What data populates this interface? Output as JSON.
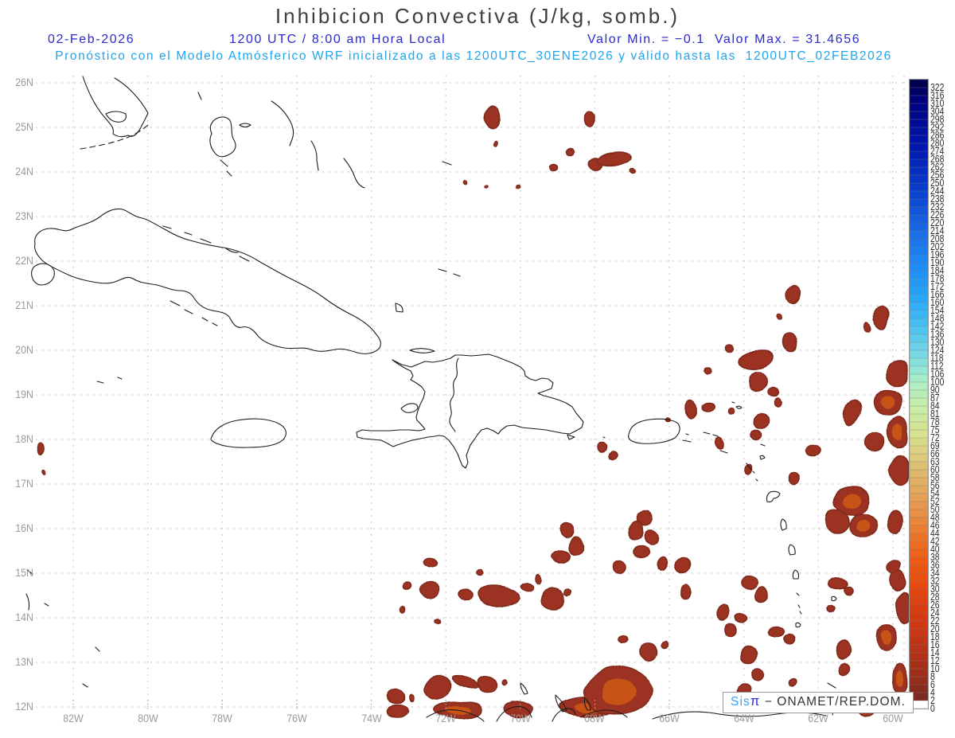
{
  "header": {
    "title": "Inhibicion Convectiva (J/kg, somb.)",
    "date": "02-Feb-2026",
    "time": "1200 UTC / 8:00 am Hora Local",
    "minmax": "Valor Min. = −0.1  Valor Max. = 31.4656",
    "forecast_line": "Pronóstico con el Modelo Atmósferico WRF inicializado a las 1200UTC_30ENE2026 y válido hasta las  1200UTC_02FEB2026"
  },
  "attribution": {
    "sis": "Sis",
    "pi": "π",
    "rest": " − ONAMET/REP.DOM."
  },
  "colors": {
    "title_gray": "#3f3f3f",
    "header_blue": "#2a2ace",
    "header_cyan": "#1fa5ee",
    "axis_gray": "#9a9a9a",
    "grid": "#c2c2c2",
    "coast": "#1c1c1c",
    "blob": "#9b3321",
    "blob_edge": "#7e2a1c",
    "blob_core": "#c85312"
  },
  "map": {
    "lat_labels": [
      "26N",
      "25N",
      "24N",
      "23N",
      "22N",
      "21N",
      "20N",
      "19N",
      "18N",
      "17N",
      "16N",
      "15N",
      "14N",
      "13N",
      "12N"
    ],
    "lon_labels": [
      "82W",
      "80W",
      "78W",
      "76W",
      "74W",
      "72W",
      "70W",
      "68W",
      "66W",
      "64W",
      "62W",
      "60W"
    ]
  },
  "colorbar": {
    "values": [
      322,
      316,
      310,
      304,
      298,
      292,
      286,
      280,
      274,
      268,
      262,
      256,
      250,
      244,
      238,
      232,
      226,
      220,
      214,
      208,
      202,
      196,
      190,
      184,
      178,
      172,
      166,
      160,
      154,
      148,
      142,
      136,
      130,
      124,
      118,
      112,
      106,
      100,
      90,
      87,
      84,
      81,
      78,
      75,
      72,
      69,
      66,
      63,
      60,
      58,
      56,
      54,
      52,
      50,
      48,
      46,
      44,
      42,
      40,
      38,
      36,
      34,
      32,
      30,
      28,
      26,
      24,
      22,
      20,
      18,
      16,
      14,
      12,
      10,
      8,
      6,
      4,
      2,
      0
    ],
    "stops": [
      [
        0,
        "#000050"
      ],
      [
        2,
        "#00007d"
      ],
      [
        8,
        "#0018b0"
      ],
      [
        14,
        "#0a44d0"
      ],
      [
        19,
        "#1a6ee8"
      ],
      [
        23,
        "#1e8cf8"
      ],
      [
        27,
        "#28a8f8"
      ],
      [
        31,
        "#50c4f0"
      ],
      [
        34,
        "#78d8e4"
      ],
      [
        36,
        "#96e8d4"
      ],
      [
        38,
        "#b2eec0"
      ],
      [
        41,
        "#c8eca4"
      ],
      [
        44,
        "#d6e28e"
      ],
      [
        46,
        "#dcd282"
      ],
      [
        48,
        "#dec073"
      ],
      [
        51,
        "#e2a85e"
      ],
      [
        54,
        "#e88f44"
      ],
      [
        57,
        "#ec7428"
      ],
      [
        60,
        "#ee5a14"
      ],
      [
        63,
        "#e64a0e"
      ],
      [
        66,
        "#da3c10"
      ],
      [
        69,
        "#c83614"
      ],
      [
        72,
        "#b03018"
      ],
      [
        75,
        "#962e1e"
      ],
      [
        77,
        "#7c2a22"
      ],
      [
        78,
        "#ffffff"
      ]
    ]
  },
  "chart_data": {
    "type": "filled_contour_map",
    "variable": "Inhibicion Convectiva",
    "units": "J/kg",
    "valor_min": -0.1,
    "valor_max": 31.4656,
    "lat_range_n": [
      12,
      26
    ],
    "lon_range_w": [
      60,
      82
    ],
    "shaded_regions": [
      [
        618,
        147,
        9,
        13,
        10,
        0
      ],
      [
        624,
        180,
        2,
        3,
        0,
        0
      ],
      [
        742,
        148,
        7,
        9,
        0,
        0
      ],
      [
        716,
        191,
        5,
        5,
        0,
        0
      ],
      [
        696,
        213,
        5,
        4,
        0,
        0
      ],
      [
        748,
        207,
        9,
        7,
        0,
        0
      ],
      [
        772,
        201,
        21,
        8,
        -8,
        0
      ],
      [
        795,
        214,
        3,
        3,
        0,
        0
      ],
      [
        586,
        228,
        2,
        2,
        0,
        0
      ],
      [
        612,
        233,
        2,
        2,
        0,
        0
      ],
      [
        650,
        236,
        2,
        2,
        0,
        0
      ],
      [
        50,
        565,
        4,
        7,
        0,
        0
      ],
      [
        54,
        594,
        2,
        3,
        0,
        0
      ],
      [
        997,
        371,
        8,
        12,
        15,
        0
      ],
      [
        980,
        399,
        3,
        3,
        0,
        0
      ],
      [
        1108,
        398,
        8,
        14,
        0,
        0
      ],
      [
        1091,
        411,
        4,
        6,
        0,
        0
      ],
      [
        992,
        431,
        9,
        12,
        0,
        0
      ],
      [
        918,
        437,
        5,
        4,
        0,
        0
      ],
      [
        950,
        452,
        23,
        12,
        -5,
        0
      ],
      [
        889,
        466,
        5,
        4,
        0,
        0
      ],
      [
        1128,
        470,
        13,
        16,
        0,
        0
      ],
      [
        953,
        480,
        12,
        12,
        0,
        0
      ],
      [
        973,
        495,
        7,
        5,
        0,
        0
      ],
      [
        978,
        507,
        4,
        5,
        0,
        0
      ],
      [
        890,
        512,
        8,
        6,
        0,
        0
      ],
      [
        920,
        516,
        4,
        4,
        0,
        0
      ],
      [
        869,
        515,
        6,
        12,
        0,
        0
      ],
      [
        840,
        527,
        3,
        2,
        0,
        0
      ],
      [
        955,
        528,
        9,
        9,
        0,
        0
      ],
      [
        951,
        547,
        6,
        7,
        0,
        0
      ],
      [
        903,
        557,
        5,
        8,
        0,
        0
      ],
      [
        940,
        589,
        5,
        6,
        0,
        0
      ],
      [
        1072,
        519,
        10,
        17,
        15,
        0
      ],
      [
        1115,
        505,
        17,
        14,
        0,
        1
      ],
      [
        1128,
        542,
        13,
        21,
        0,
        1
      ],
      [
        1100,
        556,
        11,
        11,
        0,
        0
      ],
      [
        1020,
        565,
        9,
        7,
        0,
        0
      ],
      [
        1130,
        590,
        11,
        18,
        0,
        0
      ],
      [
        757,
        561,
        6,
        6,
        0,
        0
      ],
      [
        771,
        572,
        5,
        5,
        0,
        0
      ],
      [
        997,
        601,
        6,
        8,
        0,
        0
      ],
      [
        1070,
        628,
        22,
        18,
        0,
        1
      ],
      [
        1085,
        660,
        18,
        16,
        0,
        1
      ],
      [
        1052,
        655,
        14,
        14,
        0,
        0
      ],
      [
        1124,
        655,
        9,
        12,
        0,
        0
      ],
      [
        808,
        652,
        10,
        9,
        0,
        0
      ],
      [
        798,
        668,
        9,
        12,
        0,
        0
      ],
      [
        818,
        676,
        9,
        10,
        0,
        0
      ],
      [
        712,
        668,
        9,
        8,
        0,
        0
      ],
      [
        725,
        686,
        10,
        11,
        0,
        0
      ],
      [
        706,
        700,
        12,
        8,
        0,
        0
      ],
      [
        602,
        719,
        4,
        4,
        0,
        0
      ],
      [
        678,
        727,
        4,
        6,
        0,
        0
      ],
      [
        805,
        695,
        10,
        7,
        0,
        0
      ],
      [
        832,
        708,
        5,
        8,
        0,
        0
      ],
      [
        857,
        709,
        10,
        8,
        0,
        0
      ],
      [
        864,
        741,
        6,
        10,
        0,
        0
      ],
      [
        778,
        712,
        8,
        8,
        0,
        0
      ],
      [
        542,
        706,
        8,
        7,
        0,
        0
      ],
      [
        510,
        737,
        5,
        5,
        45,
        0
      ],
      [
        538,
        742,
        12,
        10,
        0,
        0
      ],
      [
        585,
        746,
        9,
        6,
        0,
        0
      ],
      [
        627,
        749,
        26,
        11,
        8,
        0
      ],
      [
        663,
        739,
        8,
        5,
        0,
        0
      ],
      [
        696,
        752,
        13,
        14,
        0,
        0
      ],
      [
        713,
        743,
        4,
        4,
        0,
        0
      ],
      [
        506,
        765,
        3,
        4,
        0,
        0
      ],
      [
        551,
        781,
        3,
        3,
        0,
        0
      ],
      [
        940,
        733,
        11,
        9,
        0,
        0
      ],
      [
        957,
        747,
        8,
        8,
        0,
        0
      ],
      [
        1053,
        733,
        13,
        8,
        0,
        0
      ],
      [
        1068,
        742,
        6,
        5,
        0,
        0
      ],
      [
        1045,
        765,
        5,
        4,
        0,
        0
      ],
      [
        930,
        777,
        7,
        6,
        0,
        0
      ],
      [
        908,
        772,
        7,
        9,
        0,
        0
      ],
      [
        917,
        792,
        7,
        7,
        0,
        0
      ],
      [
        977,
        792,
        9,
        7,
        0,
        0
      ],
      [
        992,
        803,
        7,
        6,
        0,
        0
      ],
      [
        1128,
        730,
        10,
        14,
        0,
        0
      ],
      [
        1122,
        712,
        8,
        8,
        0,
        0
      ],
      [
        1135,
        765,
        9,
        18,
        0,
        0
      ],
      [
        1115,
        800,
        12,
        16,
        0,
        1
      ],
      [
        1060,
        816,
        9,
        13,
        0,
        0
      ],
      [
        1062,
        842,
        7,
        7,
        0,
        0
      ],
      [
        783,
        803,
        6,
        5,
        0,
        0
      ],
      [
        815,
        820,
        11,
        12,
        0,
        0
      ],
      [
        835,
        810,
        4,
        4,
        0,
        0
      ],
      [
        941,
        822,
        10,
        9,
        0,
        0
      ],
      [
        952,
        846,
        8,
        8,
        0,
        0
      ],
      [
        936,
        866,
        9,
        7,
        0,
        0
      ],
      [
        966,
        882,
        8,
        7,
        0,
        0
      ],
      [
        996,
        857,
        5,
        4,
        0,
        0
      ],
      [
        612,
        860,
        14,
        10,
        0,
        0
      ],
      [
        636,
        856,
        3,
        3,
        0,
        0
      ],
      [
        551,
        863,
        15,
        13,
        0,
        0
      ],
      [
        583,
        858,
        16,
        6,
        20,
        0
      ],
      [
        499,
        875,
        10,
        9,
        0,
        0
      ],
      [
        518,
        876,
        3,
        5,
        0,
        0
      ],
      [
        500,
        893,
        12,
        7,
        0,
        0
      ],
      [
        575,
        891,
        30,
        11,
        0,
        1
      ],
      [
        652,
        891,
        17,
        9,
        0,
        0
      ],
      [
        742,
        888,
        40,
        12,
        0,
        1
      ],
      [
        776,
        868,
        42,
        30,
        0,
        1
      ],
      [
        1132,
        852,
        10,
        18,
        0,
        1
      ],
      [
        1112,
        882,
        14,
        12,
        0,
        1
      ],
      [
        1090,
        892,
        10,
        8,
        0,
        0
      ]
    ]
  }
}
